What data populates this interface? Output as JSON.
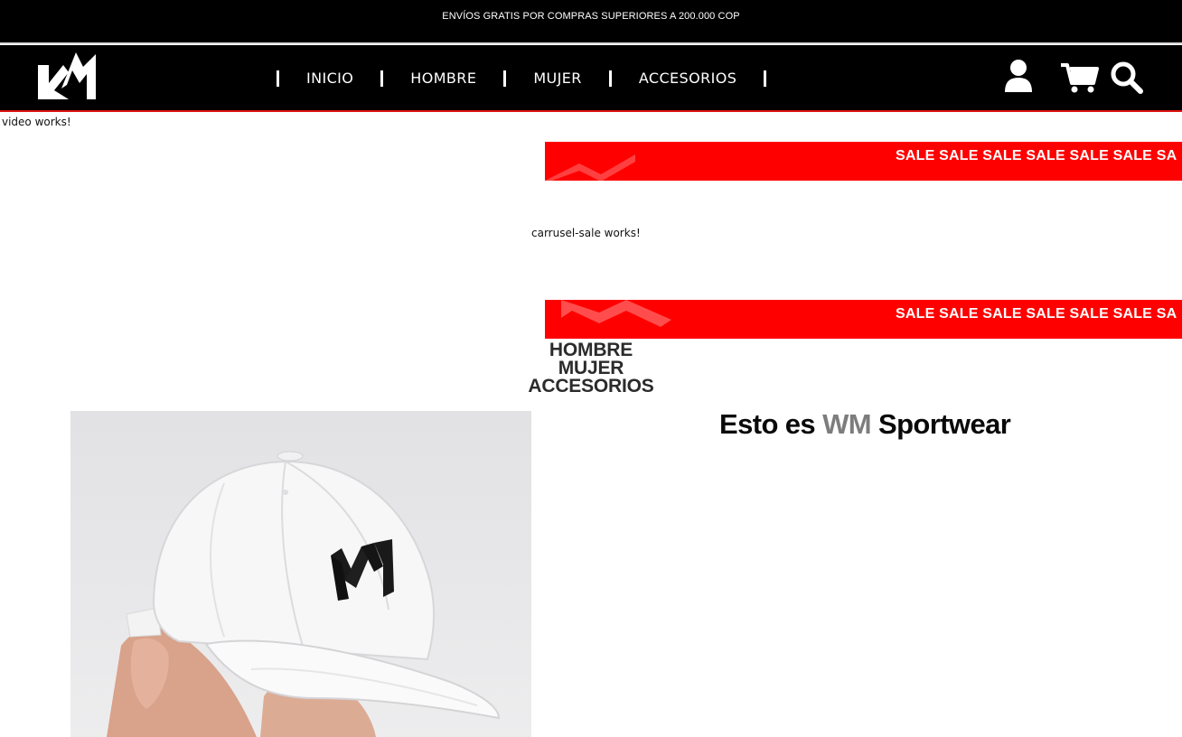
{
  "promo": {
    "text": "ENVÍOS GRATIS POR COMPRAS SUPERIORES A 200.000 COP"
  },
  "header": {
    "logo_icon": "wm-logo-icon",
    "nav": [
      {
        "label": "INICIO"
      },
      {
        "label": "HOMBRE"
      },
      {
        "label": "MUJER"
      },
      {
        "label": "ACCESORIOS"
      }
    ],
    "icons": [
      "user-icon",
      "cart-icon",
      "search-icon"
    ],
    "accent_color": "#e01313"
  },
  "page": {
    "video_placeholder": "video works!",
    "carousel_placeholder": "carrusel-sale works!"
  },
  "sale_banner": {
    "text": "SALE SALE SALE SALE SALE SALE SA",
    "color": "#ff0000"
  },
  "categories": [
    {
      "label": "HOMBRE"
    },
    {
      "label": "MUJER"
    },
    {
      "label": "ACCESORIOS"
    }
  ],
  "heading": {
    "prefix": "Esto es",
    "brand": "WM",
    "suffix": "Sportwear"
  }
}
